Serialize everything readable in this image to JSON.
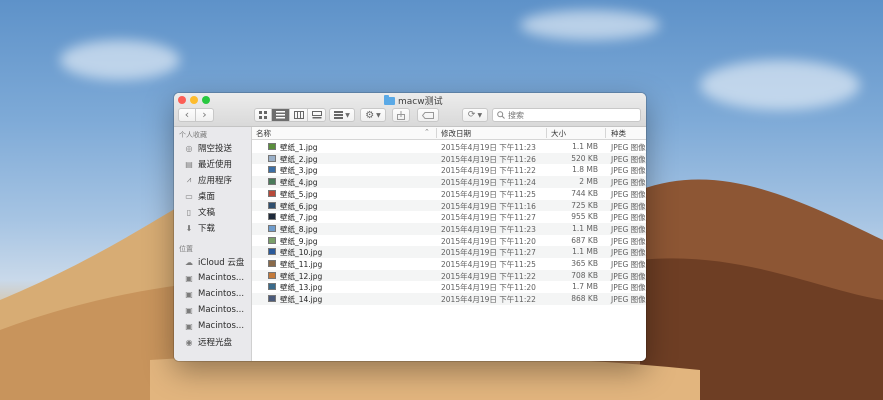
{
  "window": {
    "title": "macw测试",
    "search": {
      "placeholder": "搜索"
    }
  },
  "toolbar": {
    "back": "‹",
    "forward": "›"
  },
  "sidebar": {
    "sections": [
      {
        "heading": "个人收藏",
        "items": [
          "隔空投送",
          "最近使用",
          "应用程序",
          "桌面",
          "文稿",
          "下载"
        ]
      },
      {
        "heading": "位置",
        "items": [
          "iCloud 云盘",
          "Macintos...",
          "Macintos...",
          "Macintos...",
          "Macintos...",
          "远程光盘"
        ]
      }
    ]
  },
  "columns": {
    "name": "名称",
    "date": "修改日期",
    "size": "大小",
    "kind": "种类"
  },
  "files": [
    {
      "name": "壁纸_1.jpg",
      "date": "2015年4月19日 下午11:23",
      "size": "1.1 MB",
      "kind": "JPEG 图像",
      "color": "#5a8f3c"
    },
    {
      "name": "壁纸_2.jpg",
      "date": "2015年4月19日 下午11:26",
      "size": "520 KB",
      "kind": "JPEG 图像",
      "color": "#9ab0c8"
    },
    {
      "name": "壁纸_3.jpg",
      "date": "2015年4月19日 下午11:22",
      "size": "1.8 MB",
      "kind": "JPEG 图像",
      "color": "#3b6ea5"
    },
    {
      "name": "壁纸_4.jpg",
      "date": "2015年4月19日 下午11:24",
      "size": "2 MB",
      "kind": "JPEG 图像",
      "color": "#4a7a5a"
    },
    {
      "name": "壁纸_5.jpg",
      "date": "2015年4月19日 下午11:25",
      "size": "744 KB",
      "kind": "JPEG 图像",
      "color": "#b84a3a"
    },
    {
      "name": "壁纸_6.jpg",
      "date": "2015年4月19日 下午11:16",
      "size": "725 KB",
      "kind": "JPEG 图像",
      "color": "#2f4f6f"
    },
    {
      "name": "壁纸_7.jpg",
      "date": "2015年4月19日 下午11:27",
      "size": "955 KB",
      "kind": "JPEG 图像",
      "color": "#1e2a3a"
    },
    {
      "name": "壁纸_8.jpg",
      "date": "2015年4月19日 下午11:23",
      "size": "1.1 MB",
      "kind": "JPEG 图像",
      "color": "#6e9ccc"
    },
    {
      "name": "壁纸_9.jpg",
      "date": "2015年4月19日 下午11:20",
      "size": "687 KB",
      "kind": "JPEG 图像",
      "color": "#7aa06a"
    },
    {
      "name": "壁纸_10.jpg",
      "date": "2015年4月19日 下午11:27",
      "size": "1.1 MB",
      "kind": "JPEG 图像",
      "color": "#2a5a9a"
    },
    {
      "name": "壁纸_11.jpg",
      "date": "2015年4月19日 下午11:25",
      "size": "365 KB",
      "kind": "JPEG 图像",
      "color": "#8a6a4a"
    },
    {
      "name": "壁纸_12.jpg",
      "date": "2015年4月19日 下午11:22",
      "size": "708 KB",
      "kind": "JPEG 图像",
      "color": "#c47a3a"
    },
    {
      "name": "壁纸_13.jpg",
      "date": "2015年4月19日 下午11:20",
      "size": "1.7 MB",
      "kind": "JPEG 图像",
      "color": "#3a6a8a"
    },
    {
      "name": "壁纸_14.jpg",
      "date": "2015年4月19日 下午11:22",
      "size": "868 KB",
      "kind": "JPEG 图像",
      "color": "#4a5a7a"
    }
  ],
  "colors": {
    "close": "#fc5f57",
    "minimize": "#fdbc2e",
    "zoom": "#28c840",
    "folder": "#5aa9e6",
    "sidebar_bg": "#e9e9ec",
    "row_alt": "#f4f5f5"
  }
}
